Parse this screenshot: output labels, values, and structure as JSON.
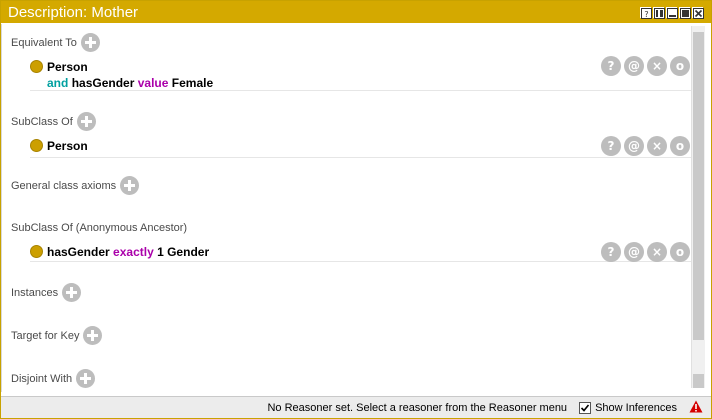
{
  "window": {
    "title": "Description: Mother",
    "controls": [
      "help-icon",
      "split-icon",
      "minimize-icon",
      "maximize-icon",
      "close-icon"
    ]
  },
  "sections": {
    "equivalent_to": {
      "title": "Equivalent To",
      "entry": {
        "line1": "Person",
        "line2_kw": "and",
        "line2_rest": "hasGender",
        "line2_kw2": "value",
        "line2_end": "Female"
      }
    },
    "subclass_of": {
      "title": "SubClass Of",
      "entry": {
        "text": "Person"
      }
    },
    "general_class_axioms": {
      "title": "General class axioms"
    },
    "subclass_anon": {
      "title": "SubClass Of (Anonymous Ancestor)",
      "entry": {
        "prop": "hasGender",
        "kw": "exactly",
        "rest": "1 Gender"
      }
    },
    "instances": {
      "title": "Instances"
    },
    "target_for_key": {
      "title": "Target for Key"
    },
    "disjoint_with": {
      "title": "Disjoint With"
    }
  },
  "entry_actions": [
    "?",
    "@",
    "×",
    "o"
  ],
  "status": {
    "message": "No Reasoner set. Select a reasoner from the Reasoner menu",
    "show_inferences_label": "Show Inferences",
    "show_inferences_checked": true
  },
  "colors": {
    "titlebar": "#d4a900",
    "bullet": "#cc9f00",
    "keyword_and": "#00a0a0",
    "keyword_value": "#aa00aa",
    "warning": "#d40000"
  }
}
